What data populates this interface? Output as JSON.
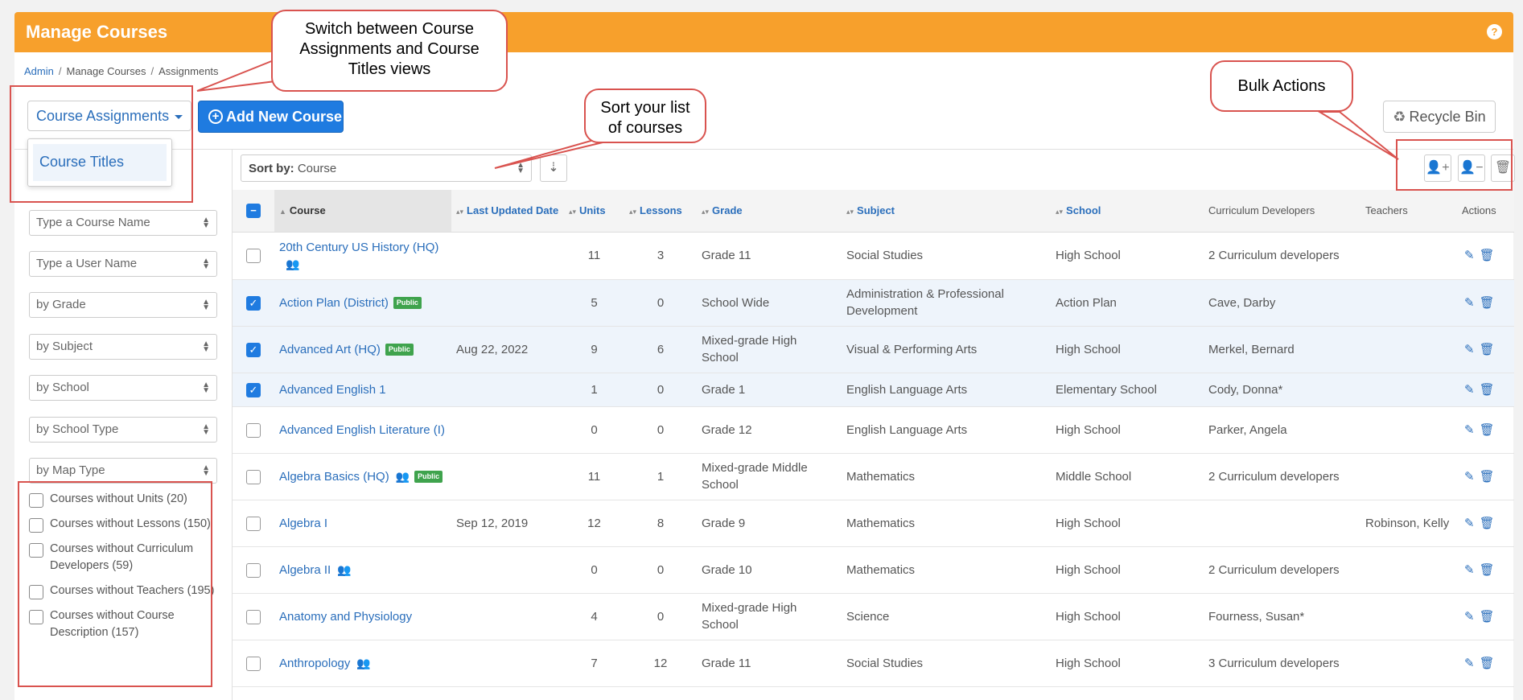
{
  "header": {
    "title": "Manage Courses",
    "help": "?"
  },
  "breadcrumb": [
    "Admin",
    "Manage Courses",
    "Assignments"
  ],
  "toolbar": {
    "view_label": "Course Assignments",
    "view_option": "Course Titles",
    "add_label": "Add New Course",
    "recycle_label": "Recycle Bin"
  },
  "filters": {
    "course_name": "Type a Course Name",
    "user_name": "Type a User Name",
    "grade": "by Grade",
    "subject": "by Subject",
    "school": "by School",
    "school_type": "by School Type",
    "map_type": "by Map Type"
  },
  "checks": [
    "Courses without Units  (20)",
    "Courses without Lessons  (150)",
    "Courses without Curriculum Developers  (59)",
    "Courses without Teachers  (195)",
    "Courses without Course Description  (157)"
  ],
  "sort": {
    "label": "Sort by:",
    "value": "Course"
  },
  "columns": {
    "course": "Course",
    "updated": "Last Updated Date",
    "units": "Units",
    "lessons": "Lessons",
    "grade": "Grade",
    "subject": "Subject",
    "school": "School",
    "developers": "Curriculum Developers",
    "teachers": "Teachers",
    "actions": "Actions"
  },
  "badge": "Public",
  "rows": [
    {
      "course": "20th Century US History (HQ)",
      "updated": "",
      "units": "11",
      "lessons": "3",
      "grade": "Grade 11",
      "subject": "Social Studies",
      "school": "High School",
      "developers": "2 Curriculum developers",
      "teachers": ""
    },
    {
      "course": "Action Plan (District)",
      "updated": "",
      "units": "5",
      "lessons": "0",
      "grade": "School Wide",
      "subject": "Administration & Professional Development",
      "school": "Action Plan",
      "developers": "Cave, Darby",
      "teachers": ""
    },
    {
      "course": "Advanced Art (HQ)",
      "updated": "Aug 22, 2022",
      "units": "9",
      "lessons": "6",
      "grade": "Mixed-grade High School",
      "subject": "Visual & Performing Arts",
      "school": "High School",
      "developers": "Merkel, Bernard",
      "teachers": ""
    },
    {
      "course": "Advanced English 1",
      "updated": "",
      "units": "1",
      "lessons": "0",
      "grade": "Grade 1",
      "subject": "English Language Arts",
      "school": "Elementary School",
      "developers": "Cody, Donna*",
      "teachers": ""
    },
    {
      "course": "Advanced English Literature (I)",
      "updated": "",
      "units": "0",
      "lessons": "0",
      "grade": "Grade 12",
      "subject": "English Language Arts",
      "school": "High School",
      "developers": "Parker, Angela",
      "teachers": ""
    },
    {
      "course": "Algebra Basics (HQ)",
      "updated": "",
      "units": "11",
      "lessons": "1",
      "grade": "Mixed-grade Middle School",
      "subject": "Mathematics",
      "school": "Middle School",
      "developers": "2 Curriculum developers",
      "teachers": ""
    },
    {
      "course": "Algebra I",
      "updated": "Sep 12, 2019",
      "units": "12",
      "lessons": "8",
      "grade": "Grade 9",
      "subject": "Mathematics",
      "school": "High School",
      "developers": "",
      "teachers": "Robinson, Kelly"
    },
    {
      "course": "Algebra II",
      "updated": "",
      "units": "0",
      "lessons": "0",
      "grade": "Grade 10",
      "subject": "Mathematics",
      "school": "High School",
      "developers": "2 Curriculum developers",
      "teachers": ""
    },
    {
      "course": "Anatomy and Physiology",
      "updated": "",
      "units": "4",
      "lessons": "0",
      "grade": "Mixed-grade High School",
      "subject": "Science",
      "school": "High School",
      "developers": "Fourness, Susan*",
      "teachers": ""
    },
    {
      "course": "Anthropology",
      "updated": "",
      "units": "7",
      "lessons": "12",
      "grade": "Grade 11",
      "subject": "Social Studies",
      "school": "High School",
      "developers": "3 Curriculum developers",
      "teachers": ""
    }
  ],
  "callouts": {
    "views": "Switch between Course Assignments and Course Titles views",
    "sort": "Sort your list of courses",
    "bulk": "Bulk Actions"
  }
}
